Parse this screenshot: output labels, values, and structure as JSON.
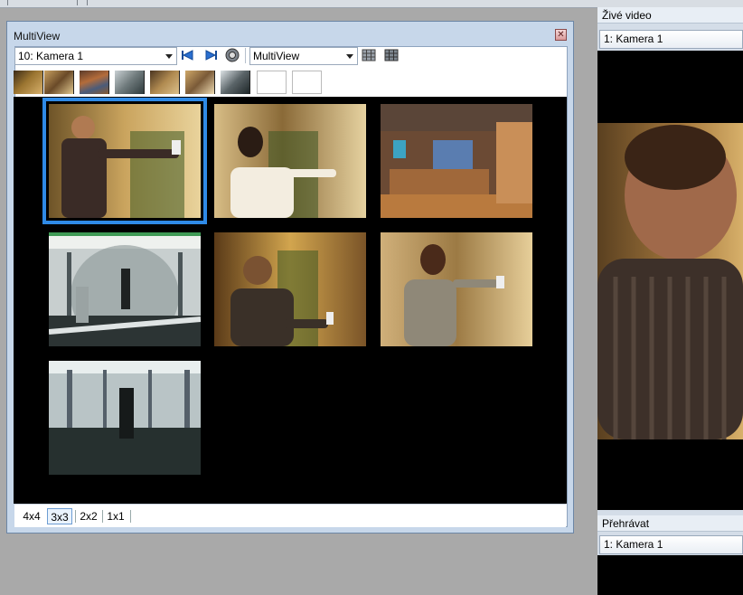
{
  "multiview": {
    "title": "MultiView",
    "camera_select": "10: Kamera 1",
    "view_select": "MultiView",
    "layout_buttons": [
      "4x4",
      "3x3",
      "2x2",
      "1x1"
    ],
    "active_layout": "3x3"
  },
  "live_video": {
    "title": "Živé video",
    "camera_select": "1: Kamera 1"
  },
  "playback": {
    "title": "Přehrávat",
    "camera_select": "1: Kamera 1"
  },
  "colors": {
    "selection": "#2f8ae6",
    "window_frame": "#c7d7ea",
    "video_bg": "#000000"
  }
}
